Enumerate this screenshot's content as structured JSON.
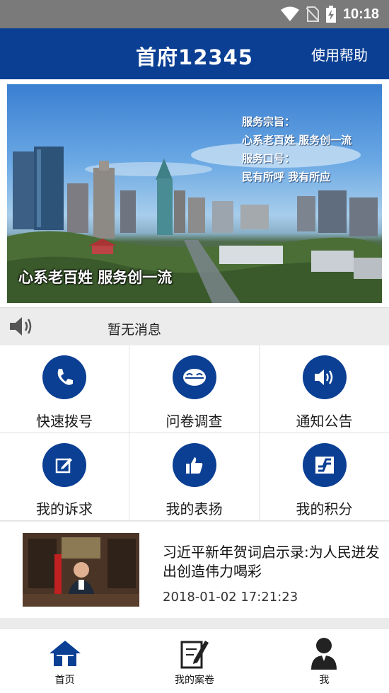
{
  "status_bar": {
    "time": "10:18",
    "icons": [
      "wifi-icon",
      "no-sim-icon",
      "battery-charging-icon"
    ]
  },
  "header": {
    "title": "首府12345",
    "help_label": "使用帮助",
    "color": "#0b3f93"
  },
  "banner": {
    "caption": "心系老百姓 服务创一流",
    "slogan_lines": [
      "服务宗旨：",
      "心系老百姓  服务创一流",
      "服务口号：",
      "民有所呼  我有所应"
    ]
  },
  "notice": {
    "icon": "speaker-icon",
    "text": "暂无消息"
  },
  "grid": {
    "items": [
      {
        "label": "快速拨号",
        "icon": "phone-icon"
      },
      {
        "label": "问卷调查",
        "icon": "survey-icon"
      },
      {
        "label": "通知公告",
        "icon": "announcement-icon"
      },
      {
        "label": "我的诉求",
        "icon": "edit-icon"
      },
      {
        "label": "我的表扬",
        "icon": "thumbs-up-icon"
      },
      {
        "label": "我的积分",
        "icon": "points-icon"
      }
    ]
  },
  "news": {
    "headline": "习近平新年贺词启示录:为人民迸发出创造伟力喝彩",
    "date": "2018-01-02 17:21:23"
  },
  "bottom_nav": {
    "items": [
      {
        "label": "首页",
        "icon": "home-icon"
      },
      {
        "label": "我的案卷",
        "icon": "case-file-icon"
      },
      {
        "label": "我",
        "icon": "user-icon"
      }
    ]
  }
}
